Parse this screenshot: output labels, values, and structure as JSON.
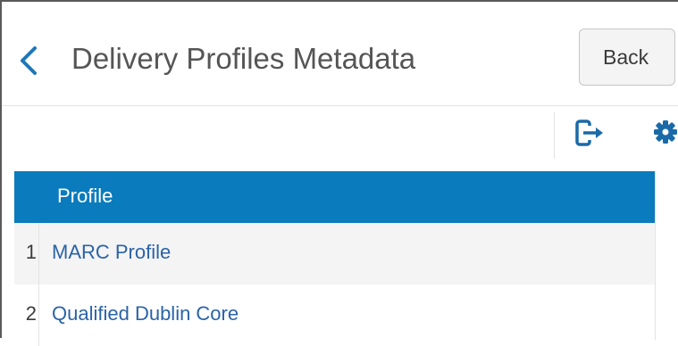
{
  "header": {
    "title": "Delivery Profiles Metadata",
    "back_button_label": "Back"
  },
  "toolbar": {
    "export_icon": "export-icon",
    "settings_icon": "gear-icon"
  },
  "grid": {
    "columns": [
      "Profile"
    ],
    "rows": [
      {
        "number": "1",
        "profile": "MARC Profile"
      },
      {
        "number": "2",
        "profile": "Qualified Dublin Core"
      }
    ]
  },
  "colors": {
    "accent": "#0a7bbd",
    "link": "#2b63a7",
    "title_text": "#555555"
  }
}
